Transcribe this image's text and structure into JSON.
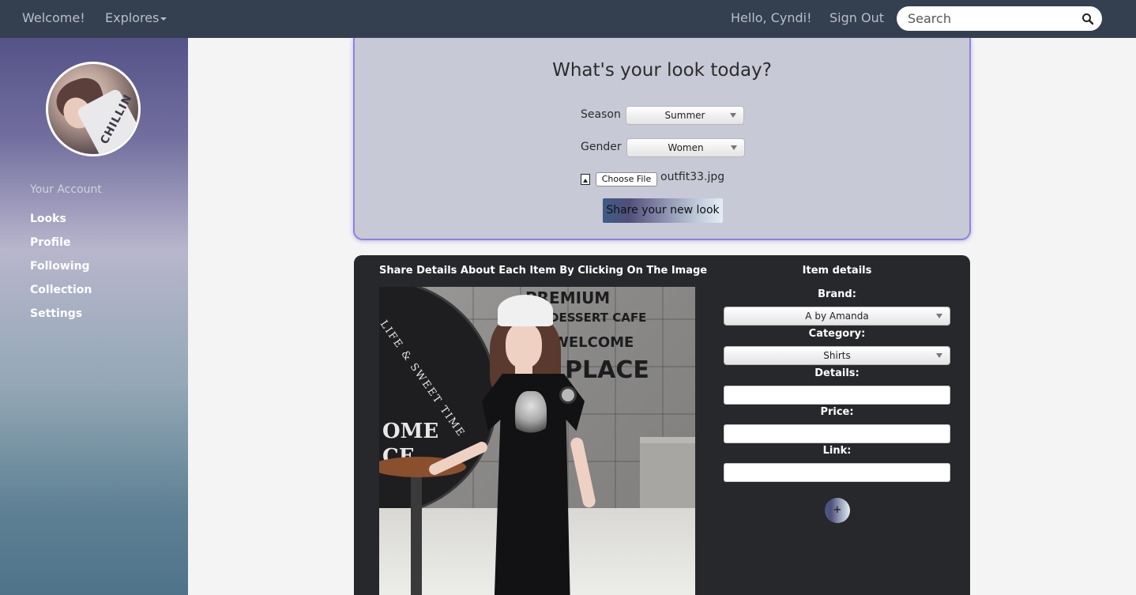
{
  "navbar": {
    "welcome": "Welcome!",
    "explores": "Explores",
    "greeting": "Hello, Cyndi!",
    "sign_out": "Sign Out",
    "search_placeholder": "Search"
  },
  "sidebar": {
    "avatar_shirt_text": "CHILLIN",
    "account_title": "Your Account",
    "items": [
      {
        "label": "Looks"
      },
      {
        "label": "Profile"
      },
      {
        "label": "Following"
      },
      {
        "label": "Collection"
      },
      {
        "label": "Settings"
      }
    ]
  },
  "upload": {
    "title": "What's your look today?",
    "season_label": "Season",
    "season_value": "Summer",
    "gender_label": "Gender",
    "gender_value": "Women",
    "choose_file": "Choose File",
    "file_name": "outfit33.jpg",
    "share_button": "Share your new look"
  },
  "details": {
    "image_title": "Share Details About Each Item By Clicking On The Image",
    "panel_title": "Item details",
    "brand_label": "Brand:",
    "brand_value": "A by Amanda",
    "category_label": "Category:",
    "category_value": "Shirts",
    "details_label": "Details:",
    "price_label": "Price:",
    "link_label": "Link:",
    "add_button": "+"
  },
  "photo_text": {
    "disc": "LIFE & SWEET TIME",
    "sign_line1": "PREMIUM",
    "sign_line2": "DESSERT CAFE",
    "sign_line3": "WELCOME",
    "sign_line4": "PLACE",
    "bottom1": "OME",
    "bottom2": "CE"
  },
  "colors": {
    "navbar_bg": "#343f4f",
    "card_bg": "#c7c9d6",
    "card_border": "#8c83e0",
    "panel_bg": "#26282b"
  }
}
